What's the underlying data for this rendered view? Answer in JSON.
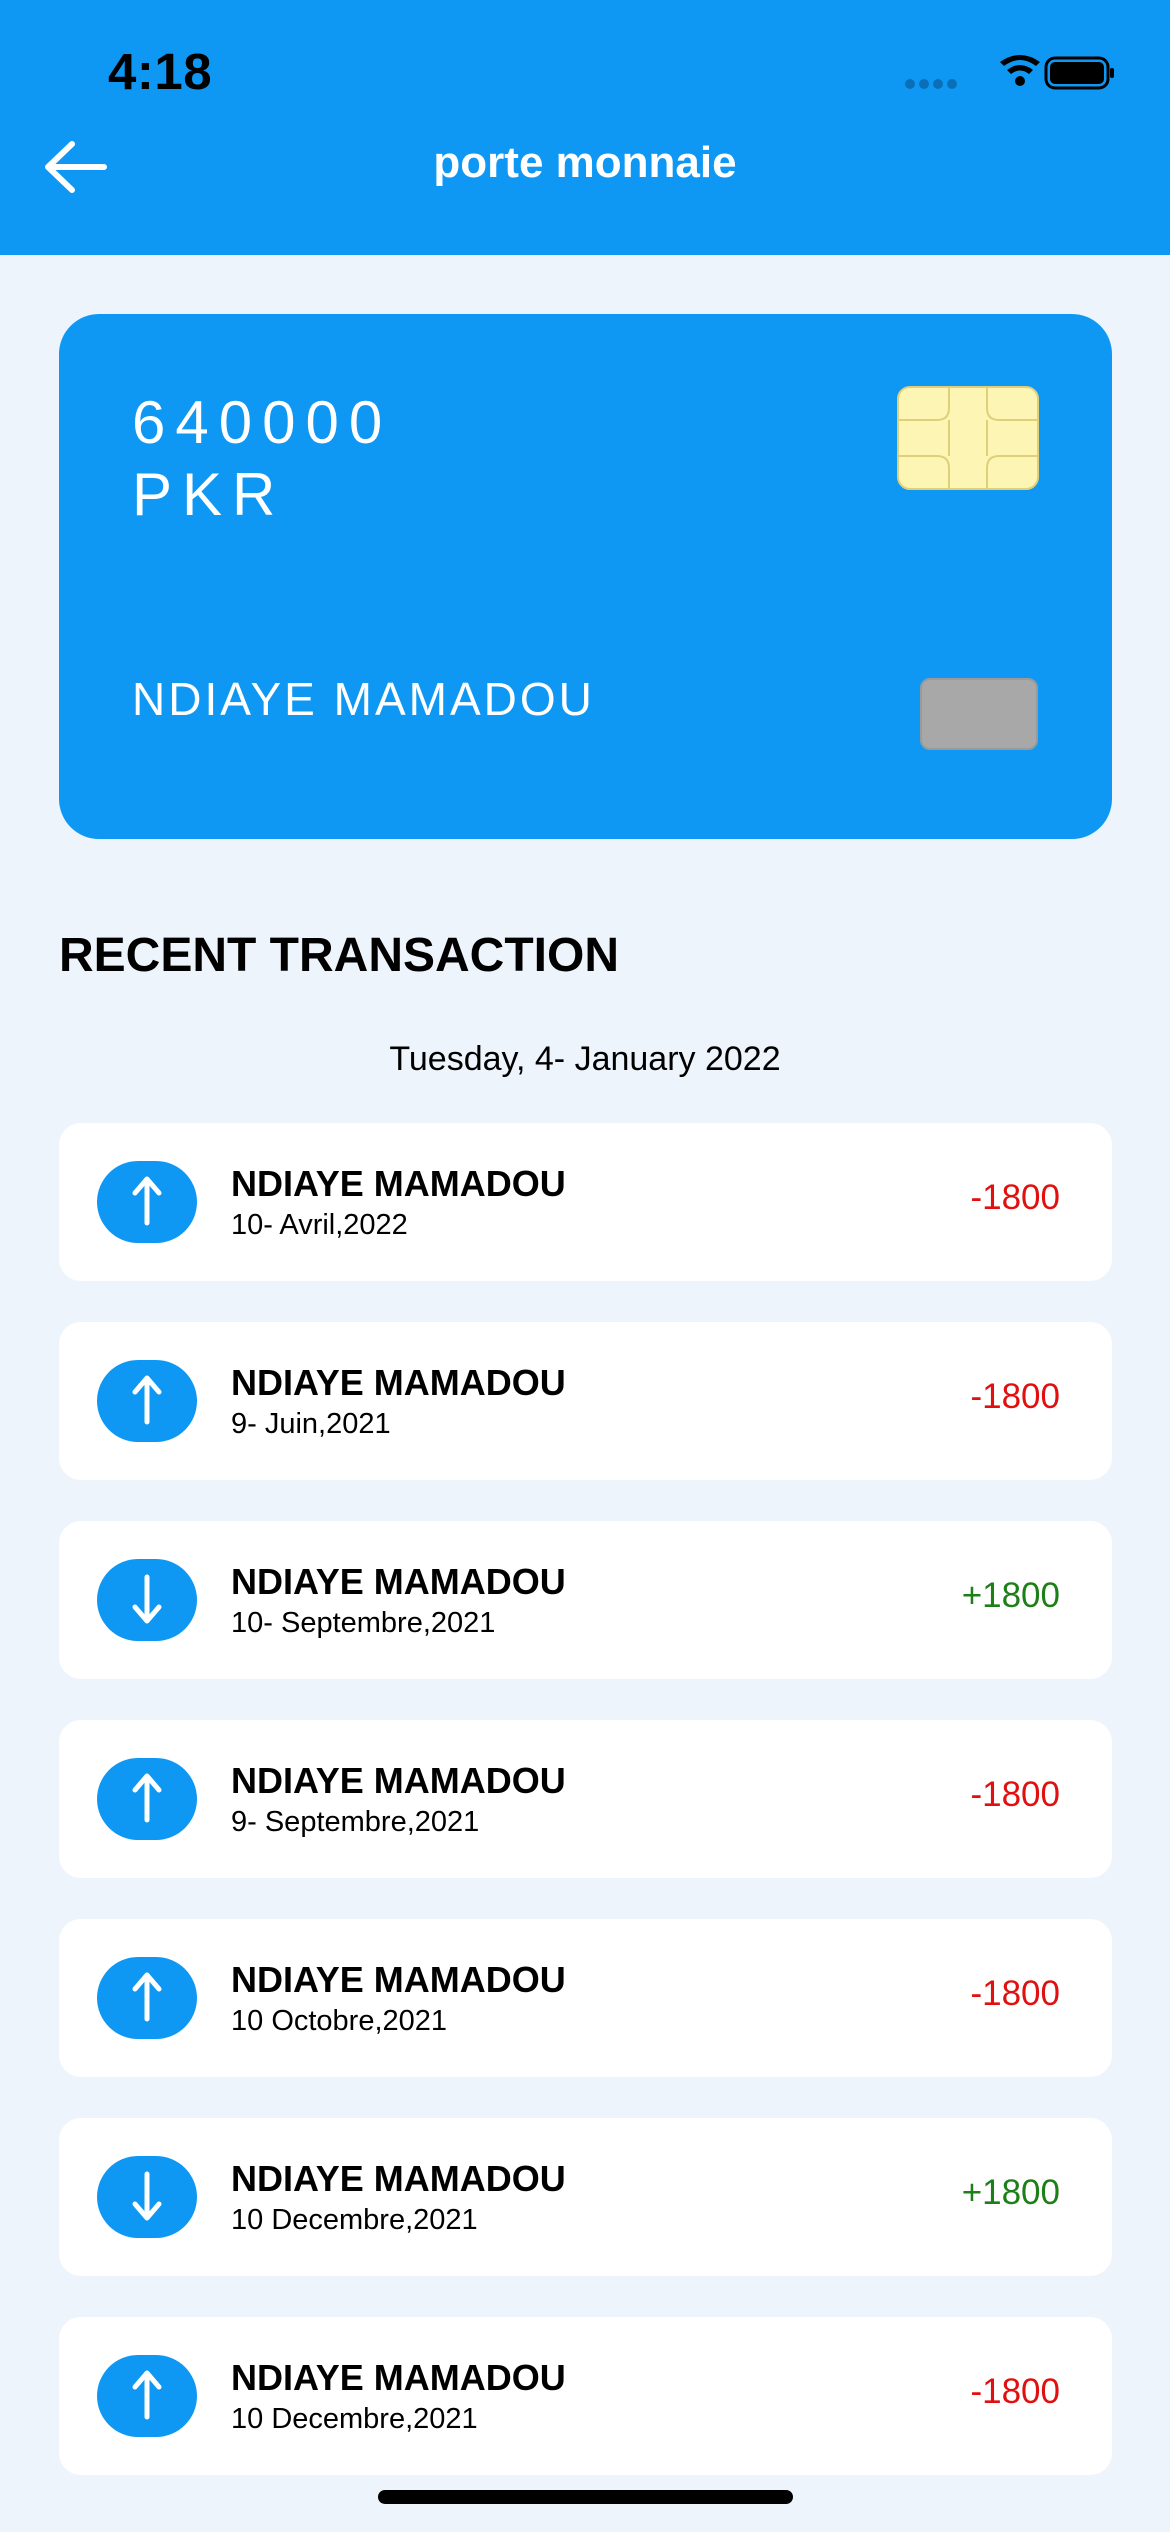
{
  "status_bar": {
    "time": "4:18"
  },
  "header": {
    "title": "porte monnaie",
    "back_icon": "arrow-left-icon"
  },
  "card": {
    "balance": "640000",
    "currency": "PKR",
    "holder": "NDIAYE MAMADOU",
    "chip_icon": "sim-chip-icon"
  },
  "recent": {
    "title": "RECENT TRANSACTION",
    "date_heading": "Tuesday, 4- January 2022"
  },
  "transactions": [
    {
      "name": "NDIAYE MAMADOU",
      "date": "10- Avril,2022",
      "amount": "-1800",
      "direction": "up"
    },
    {
      "name": "NDIAYE MAMADOU",
      "date": "9- Juin,2021",
      "amount": "-1800",
      "direction": "up"
    },
    {
      "name": "NDIAYE MAMADOU",
      "date": "10- Septembre,2021",
      "amount": "+1800",
      "direction": "down"
    },
    {
      "name": "NDIAYE MAMADOU",
      "date": "9- Septembre,2021",
      "amount": "-1800",
      "direction": "up"
    },
    {
      "name": "NDIAYE MAMADOU",
      "date": "10 Octobre,2021",
      "amount": "-1800",
      "direction": "up"
    },
    {
      "name": "NDIAYE MAMADOU",
      "date": "10 Decembre,2021",
      "amount": "+1800",
      "direction": "down"
    },
    {
      "name": "NDIAYE MAMADOU",
      "date": "10 Decembre,2021",
      "amount": "-1800",
      "direction": "up"
    }
  ],
  "colors": {
    "primary": "#0e98f4",
    "background": "#eef4fc",
    "debit": "#e10f0f",
    "credit": "#1c7f17"
  }
}
